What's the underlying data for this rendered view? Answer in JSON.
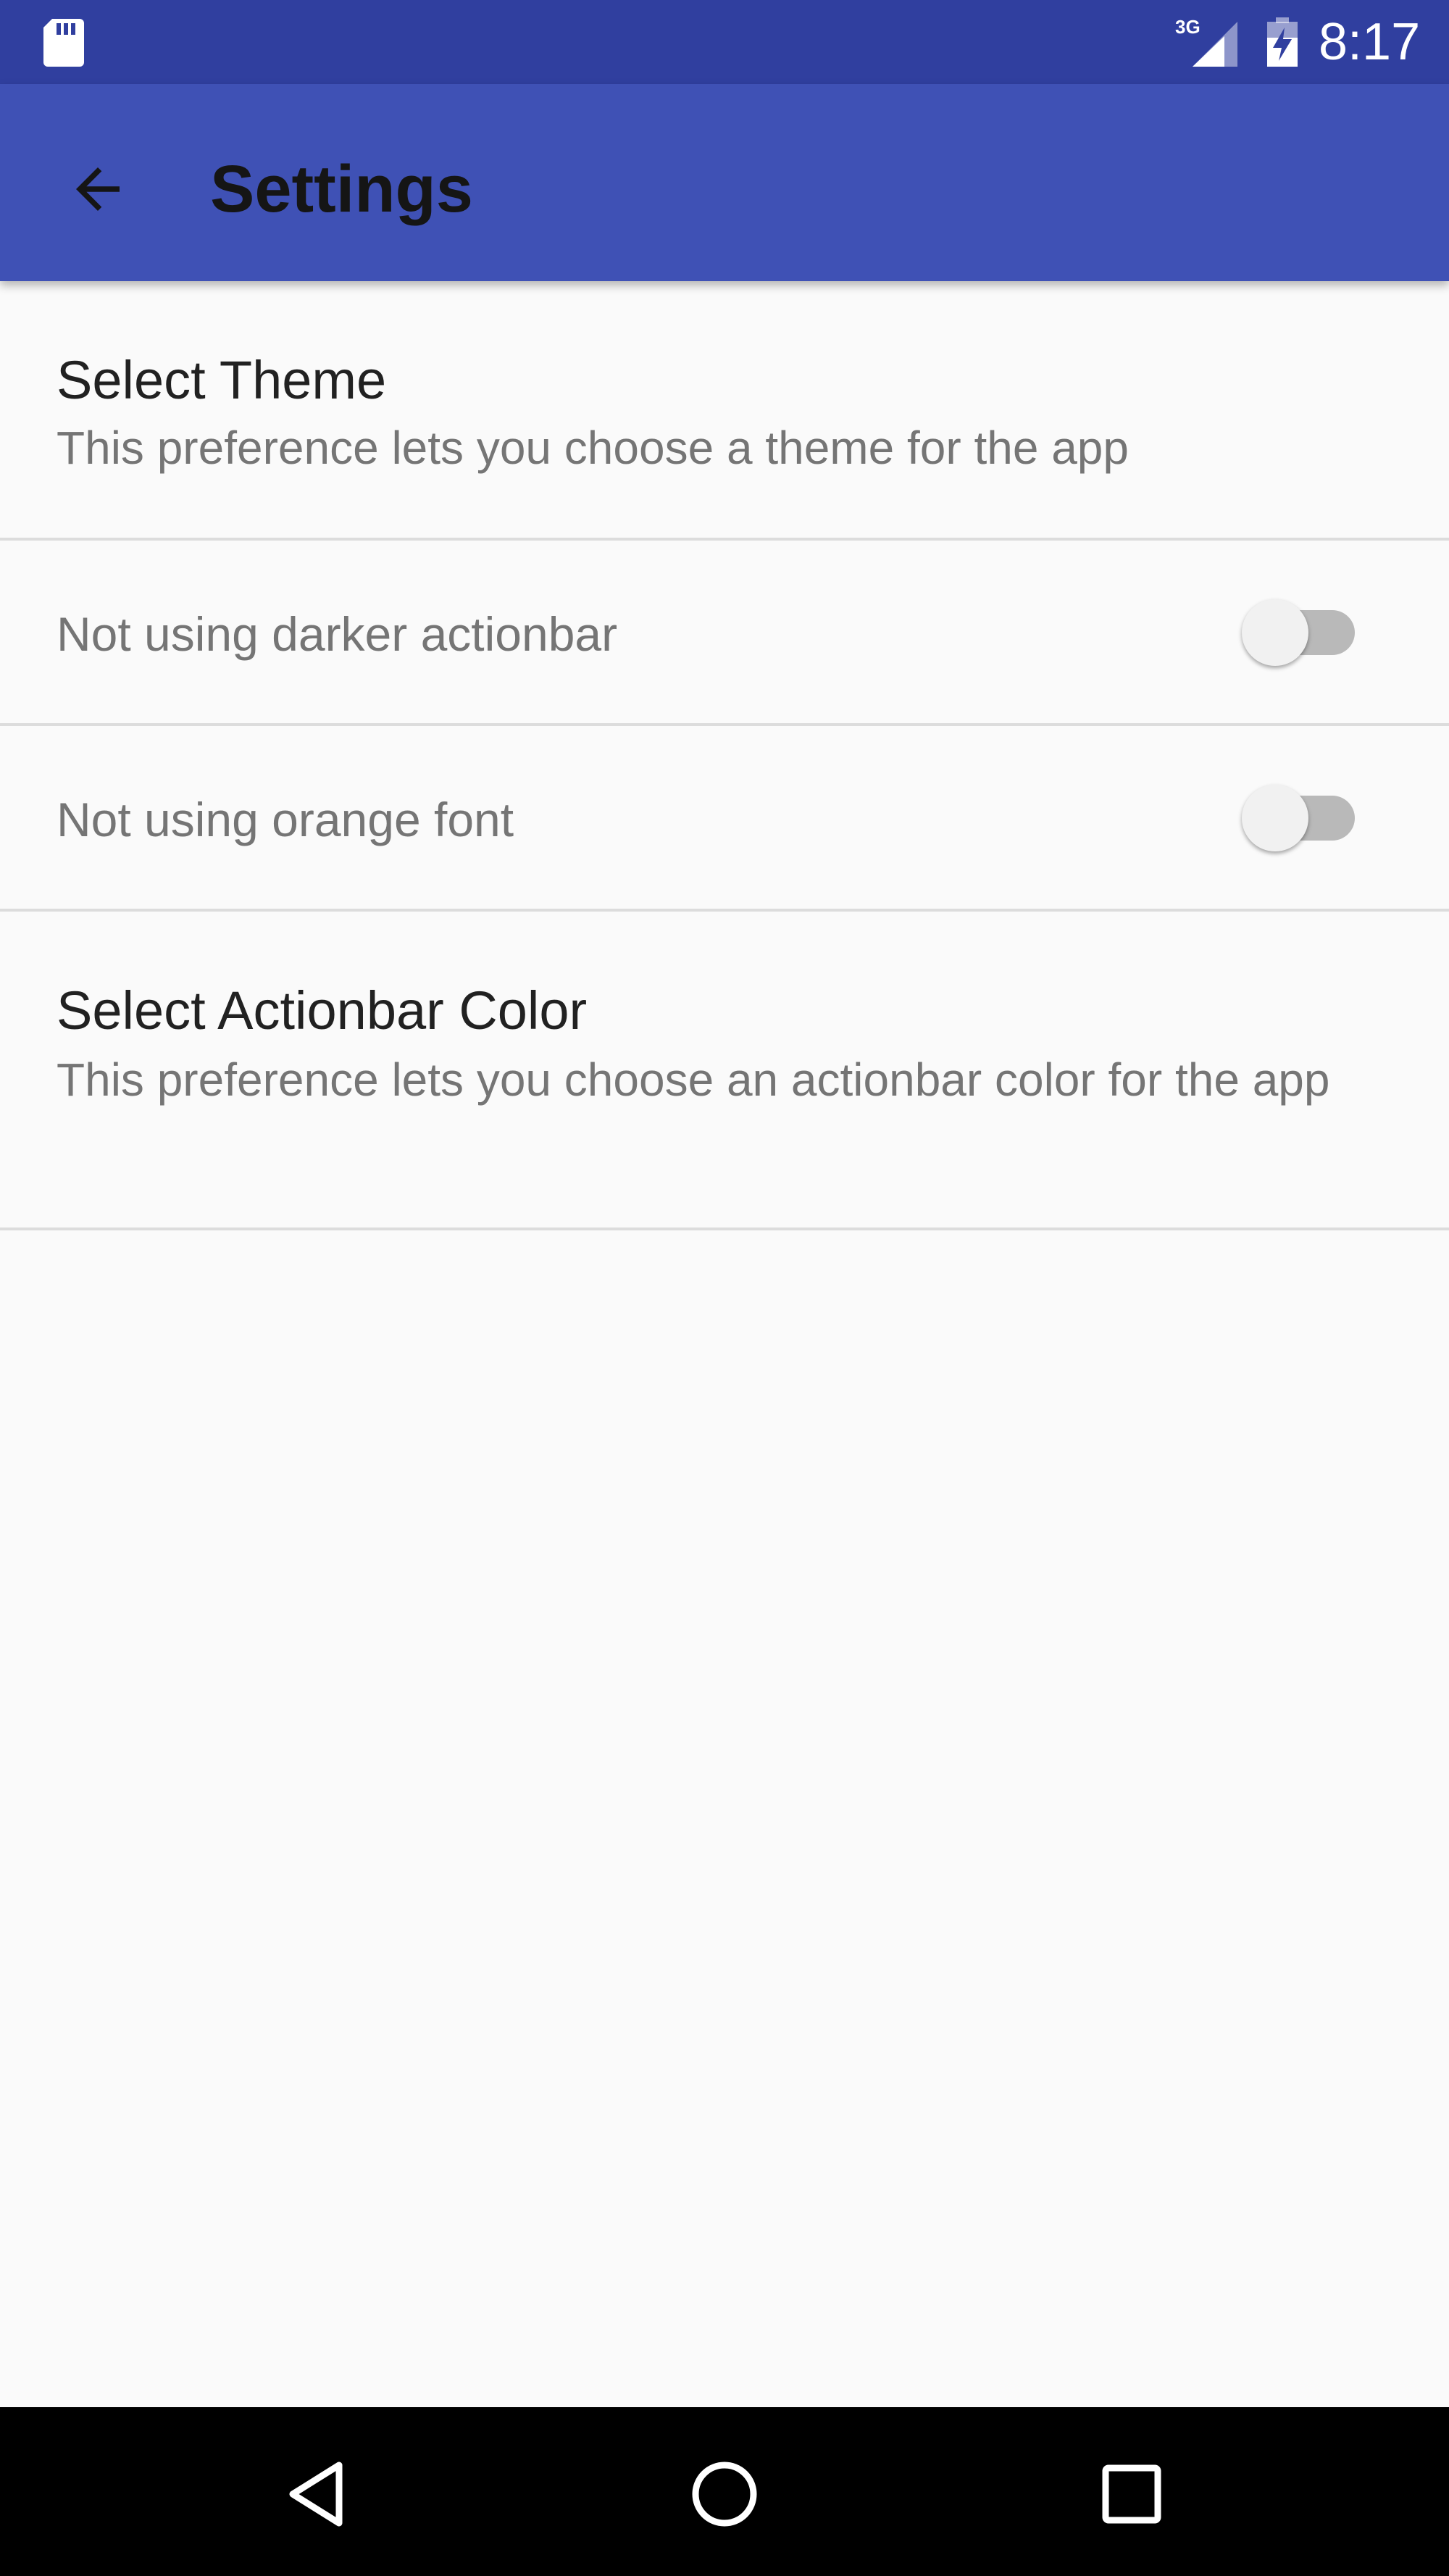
{
  "status_bar": {
    "time": "8:17",
    "network": "3G",
    "icons": [
      "sd-card-icon",
      "signal-icon",
      "battery-charging-icon"
    ],
    "background": "#303f9f"
  },
  "app_bar": {
    "title": "Settings",
    "back_icon": "arrow-back-icon",
    "background": "#3f51b5"
  },
  "preferences": [
    {
      "type": "list",
      "title": "Select Theme",
      "summary": "This preference lets you choose a theme for the app"
    },
    {
      "type": "switch",
      "title": "Not using darker actionbar",
      "checked": false
    },
    {
      "type": "switch",
      "title": "Not using orange font",
      "checked": false
    },
    {
      "type": "list",
      "title": "Select Actionbar Color",
      "summary": "This preference lets you choose an actionbar color for the app"
    }
  ],
  "nav_bar": {
    "buttons": [
      "back-triangle-icon",
      "home-circle-icon",
      "recents-square-icon"
    ]
  }
}
